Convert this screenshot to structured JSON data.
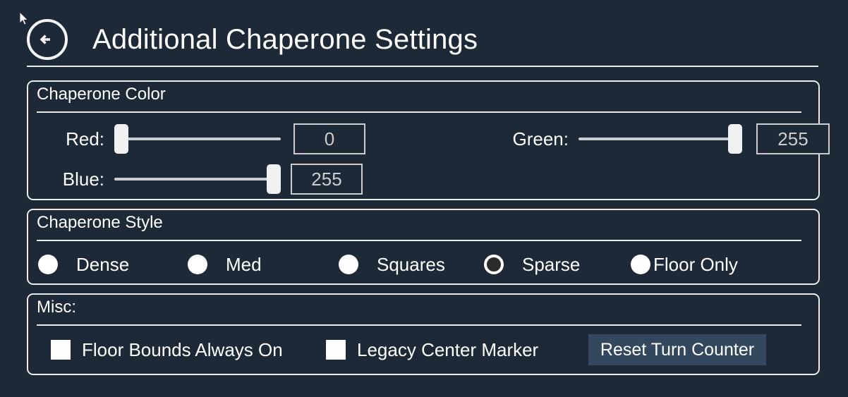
{
  "header": {
    "back_icon": "back-arrow-circle-icon",
    "title": "Additional Chaperone Settings"
  },
  "cursor": {
    "icon": "mouse-pointer-icon"
  },
  "color_group": {
    "title": "Chaperone Color",
    "sliders": [
      {
        "label": "Red:",
        "value": "0",
        "fill_percent": 0
      },
      {
        "label": "Blue:",
        "value": "255",
        "fill_percent": 100
      },
      {
        "label": "Green:",
        "value": "255",
        "fill_percent": 100
      }
    ]
  },
  "style_group": {
    "title": "Chaperone Style",
    "options": [
      {
        "label": "Dense",
        "selected": false
      },
      {
        "label": "Med",
        "selected": false
      },
      {
        "label": "Squares",
        "selected": false
      },
      {
        "label": "Sparse",
        "selected": true
      },
      {
        "label": "Floor Only",
        "selected": false
      }
    ]
  },
  "misc_group": {
    "title": "Misc:",
    "checkboxes": [
      {
        "label": "Floor Bounds Always On",
        "checked": false
      },
      {
        "label": "Legacy Center Marker",
        "checked": false
      }
    ],
    "button_label": "Reset Turn Counter"
  },
  "colors": {
    "background": "#1e2937",
    "border": "#e8ebee",
    "text": "#ffffff",
    "value_text": "#c9ccd0",
    "button_fill": "#33475f"
  }
}
